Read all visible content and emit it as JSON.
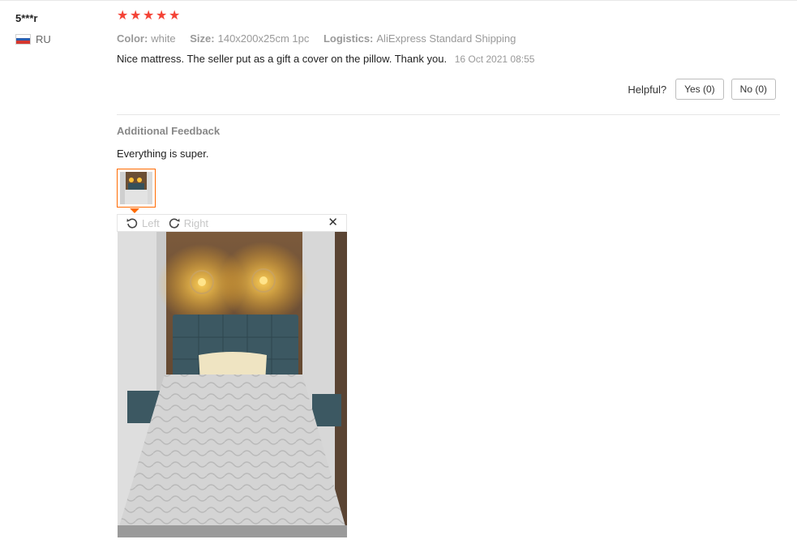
{
  "user": {
    "name": "5***r",
    "country": "RU"
  },
  "review": {
    "rating": 5,
    "attributes": [
      {
        "key": "Color:",
        "value": "white"
      },
      {
        "key": "Size:",
        "value": "140x200x25cm 1pc"
      },
      {
        "key": "Logistics:",
        "value": "AliExpress Standard Shipping"
      }
    ],
    "text": "Nice mattress. The seller put as a gift a cover on the pillow. Thank you.",
    "date": "16 Oct 2021 08:55"
  },
  "helpful": {
    "label": "Helpful?",
    "yes": "Yes (0)",
    "no": "No (0)"
  },
  "additional": {
    "title": "Additional Feedback",
    "text": "Everything is super."
  },
  "viewer": {
    "left_label": "Left",
    "right_label": "Right",
    "close_glyph": "✕"
  },
  "colors": {
    "star": "#f44336",
    "accent": "#ff6a00"
  },
  "icons": {
    "rotate_left": "rotate-left-icon",
    "rotate_right": "rotate-right-icon",
    "close": "close-icon",
    "star": "star-icon"
  }
}
